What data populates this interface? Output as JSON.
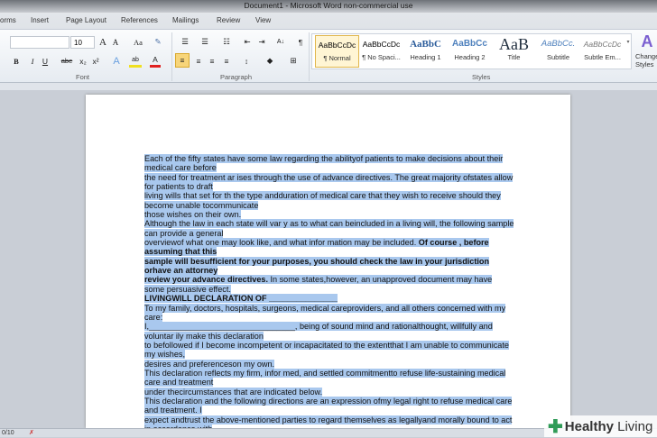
{
  "window": {
    "title": "Document1 - Microsoft Word non-commercial use"
  },
  "tabs": [
    "orms",
    "Insert",
    "Page Layout",
    "References",
    "Mailings",
    "Review",
    "View"
  ],
  "font": {
    "name": "",
    "size": "10",
    "group_label": "Font",
    "grow": "A",
    "shrink": "A",
    "case": "Aa",
    "bold": "B",
    "italic": "I",
    "underline": "U",
    "strike": "abe",
    "sub": "x₂",
    "sup": "x²",
    "effects": "A",
    "highlight": "ab",
    "color": "A"
  },
  "paragraph": {
    "group_label": "Paragraph",
    "show_marks": "¶",
    "sort": "A↓"
  },
  "styles": {
    "group_label": "Styles",
    "items": [
      {
        "sample": "AaBbCcDc",
        "name": "¶ Normal"
      },
      {
        "sample": "AaBbCcDc",
        "name": "¶ No Spaci..."
      },
      {
        "sample": "AaBbC",
        "name": "Heading 1"
      },
      {
        "sample": "AaBbCc",
        "name": "Heading 2"
      },
      {
        "sample": "AaB",
        "name": "Title"
      },
      {
        "sample": "AaBbCc.",
        "name": "Subtitle"
      },
      {
        "sample": "AaBbCcDc",
        "name": "Subtle Em..."
      }
    ],
    "change_styles": "Change Styles"
  },
  "document": {
    "lines": [
      [
        {
          "t": "Each of the fifty states have some law regarding the abilityof patients to make decisions about their"
        }
      ],
      [
        {
          "t": "medical care before"
        }
      ],
      [
        {
          "t": "the need for treatment ar ises through the use of advance directives. The great majority ofstates allow"
        }
      ],
      [
        {
          "t": "for patients to draft"
        }
      ],
      [
        {
          "t": "living wills that set for th the type andduration of medical care that they wish to receive should they"
        }
      ],
      [
        {
          "t": "become unable tocommunicate"
        }
      ],
      [
        {
          "t": "those wishes on their own."
        }
      ],
      [
        {
          "t": "Although the law in each state will var y as to what can beincluded in a living will, the following sample"
        }
      ],
      [
        {
          "t": "can provide a general"
        }
      ],
      [
        {
          "t": "overviewof what one may look like, and what infor mation may be included. "
        },
        {
          "t": "Of course , before",
          "b": true
        }
      ],
      [
        {
          "t": "assuming that this",
          "b": true
        }
      ],
      [
        {
          "t": "sample will besufficient for your purposes, you should check the law in your jurisdiction",
          "b": true
        }
      ],
      [
        {
          "t": "orhave an attorney",
          "b": true
        }
      ],
      [
        {
          "t": "review your advance directives.",
          "b": true
        },
        {
          "t": " In some states,however, an unapproved document may have"
        }
      ],
      [
        {
          "t": "some persuasive effect."
        }
      ],
      [
        {
          "t": "LIVINGWILL DECLARATION OF _______________",
          "b": true
        }
      ],
      [
        {
          "t": "To my family, doctors, hospitals, surgeons, medical careproviders, and all others concerned with my"
        }
      ],
      [
        {
          "t": "care:"
        }
      ],
      [
        {
          "t": "I,________________________________,  being of sound mind and rationalthought, willfully and"
        }
      ],
      [
        {
          "t": "voluntar ily make this declaration"
        }
      ],
      [
        {
          "t": "to befollowed if I become incompetent or incapacitated to the extentthat I am unable to communicate"
        }
      ],
      [
        {
          "t": "my wishes,"
        }
      ],
      [
        {
          "t": "desires and preferenceson my own."
        }
      ],
      [
        {
          "t": "This declaration reflects my firm, infor med, and settled commitmentto refuse life-sustaining medical"
        }
      ],
      [
        {
          "t": "care and treatment"
        }
      ],
      [
        {
          "t": "under thecircumstances that are indicated below."
        }
      ],
      [
        {
          "t": "This declaration and the following directions are an expression ofmy legal right to refuse medical care"
        }
      ],
      [
        {
          "t": "and treatment. I"
        }
      ],
      [
        {
          "t": "expect andtrust the above-mentioned parties to regard themselves as legallyand morally bound to act"
        }
      ],
      [
        {
          "t": "in accordance with"
        }
      ]
    ]
  },
  "status": {
    "page": "0/10"
  },
  "watermark": {
    "brand": "Healthy Living"
  },
  "colors": {
    "selection": "#a9c8ee",
    "accent_active": "#f5c55a"
  }
}
